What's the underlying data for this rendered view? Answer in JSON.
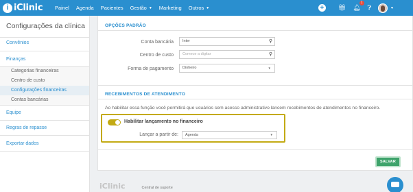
{
  "brand": {
    "name": "iClinic"
  },
  "nav": {
    "items": [
      {
        "label": "Painel"
      },
      {
        "label": "Agenda"
      },
      {
        "label": "Pacientes"
      },
      {
        "label": "Gestão",
        "caret": "▼"
      },
      {
        "label": "Marketing"
      },
      {
        "label": "Outros",
        "caret": "▼"
      }
    ]
  },
  "topbar": {
    "notifications_count": "1",
    "icons": [
      "plus-icon",
      "gift-icon",
      "bell-icon",
      "help-icon",
      "avatar"
    ]
  },
  "sidebar": {
    "title": "Configurações da clínica",
    "items": [
      {
        "label": "Convênios"
      },
      {
        "label": "Finanças"
      },
      {
        "label": "Equipe"
      },
      {
        "label": "Regras de repasse"
      },
      {
        "label": "Exportar dados"
      }
    ],
    "sub_items": [
      {
        "label": "Categorias financeiras"
      },
      {
        "label": "Centro de custo"
      },
      {
        "label": "Configurações financeiras",
        "active": true
      },
      {
        "label": "Contas bancárias"
      }
    ]
  },
  "defaults": {
    "heading": "OPÇÕES PADRÃO",
    "bank_label": "Conta bancária",
    "bank_value": "Inter",
    "cost_label": "Centro de custo",
    "cost_placeholder": "Comece a digitar",
    "payment_label": "Forma de pagamento",
    "payment_value": "Dinheiro"
  },
  "receipts": {
    "heading": "RECEBIMENTOS DE ATENDIMENTO",
    "description": "Ao habilitar essa função você permitirá que usuários sem acesso administrativo lancem recebimentos de atendimentos no financeiro.",
    "toggle_label": "Habilitar lançamento no financeiro",
    "toggle_on": true,
    "launch_label": "Lançar a partir de:",
    "launch_value": "Agenda"
  },
  "actions": {
    "save_label": "SALVAR"
  },
  "footer": {
    "logo": "iClinic",
    "support_link": "Central de suporte"
  },
  "colors": {
    "primary": "#2a8fcf",
    "highlight": "#c3aa13",
    "save": "#3ea36b",
    "badge": "#e74c3c"
  }
}
